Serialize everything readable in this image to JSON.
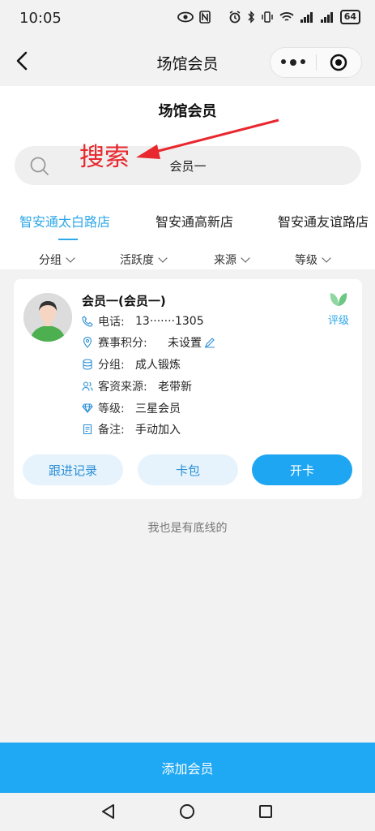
{
  "status_bar": {
    "time": "10:05",
    "network": "6",
    "battery": "64"
  },
  "nav": {
    "title": "场馆会员"
  },
  "header": {
    "title": "场馆会员",
    "search_value": "会员一",
    "annotation": "搜索"
  },
  "tabs": [
    {
      "label": "智安通太白路店",
      "active": true
    },
    {
      "label": "智安通高新店",
      "active": false
    },
    {
      "label": "智安通友谊路店",
      "active": false
    }
  ],
  "filters": [
    {
      "label": "分组"
    },
    {
      "label": "活跃度"
    },
    {
      "label": "来源"
    },
    {
      "label": "等级"
    }
  ],
  "member": {
    "name": "会员一(会员一)",
    "rating_label": "评级",
    "rows": [
      {
        "icon": "phone-icon",
        "label": "电话:",
        "value": "13·······1305"
      },
      {
        "icon": "location-icon",
        "label": "赛事积分:",
        "value": "未设置"
      },
      {
        "icon": "database-icon",
        "label": "分组:",
        "value": "成人锻炼"
      },
      {
        "icon": "people-icon",
        "label": "客资来源:",
        "value": "老带新"
      },
      {
        "icon": "diamond-icon",
        "label": "等级:",
        "value": "三星会员"
      },
      {
        "icon": "note-icon",
        "label": "备注:",
        "value": "手动加入"
      }
    ],
    "buttons": {
      "follow": "跟进记录",
      "card_pack": "卡包",
      "open_card": "开卡"
    }
  },
  "footer_note": "我也是有底线的",
  "add_button": "添加会员",
  "colors": {
    "accent": "#1ea6f2",
    "annotation": "#e8282e",
    "background": "#f2f2f2"
  }
}
